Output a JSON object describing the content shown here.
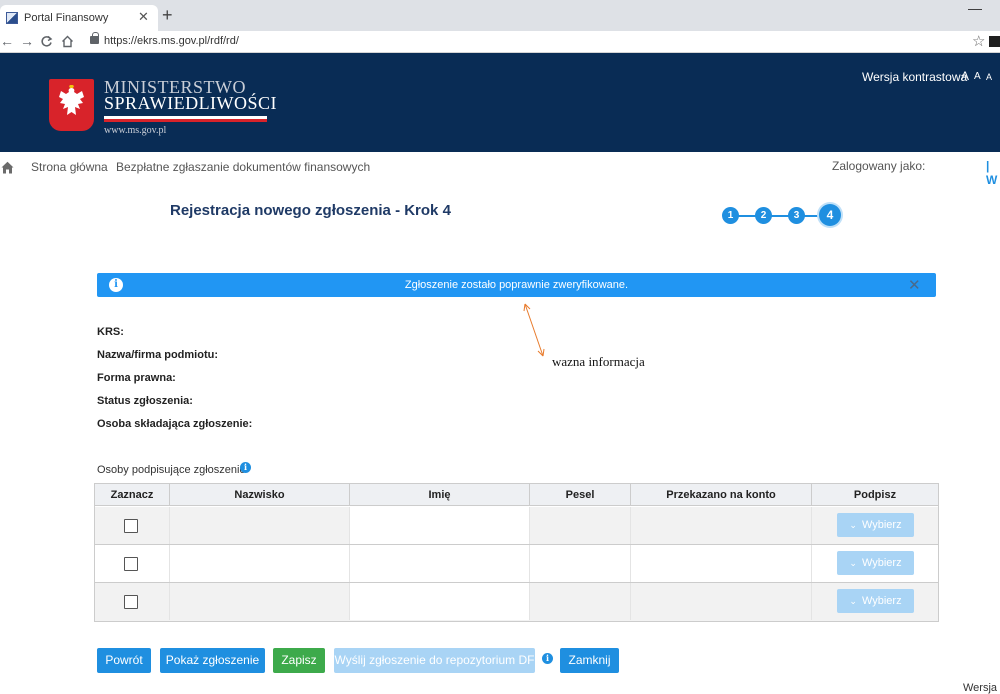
{
  "browser": {
    "tab_title": "Portal Finansowy",
    "tab_close": "✕",
    "new_tab": "+",
    "url": "https://ekrs.ms.gov.pl/rdf/rd/",
    "minimize": "—",
    "star": "☆",
    "back": "←",
    "forward": "→",
    "reload": "C"
  },
  "header": {
    "logo_line1": "MINISTERSTWO",
    "logo_line2": "SPRAWIEDLIWOŚCI",
    "logo_url": "www.ms.gov.pl",
    "contrast_label": "Wersja kontrastowa",
    "font_big": "A",
    "font_mid": "A",
    "font_small": "A",
    "colors": {
      "background": "#092c55",
      "emblem": "#d8232a"
    }
  },
  "breadcrumb": {
    "home_icon": "home-icon",
    "item1": "Strona główna",
    "item2": "Bezpłatne zgłaszanie dokumentów finansowych",
    "logged_label": "Zalogowany jako:",
    "logged_tail": "| W"
  },
  "main": {
    "title": "Rejestracja nowego zgłoszenia - Krok 4",
    "steps": [
      "1",
      "2",
      "3",
      "4"
    ],
    "active_step": 4,
    "alert": {
      "icon": "i",
      "text": "Zgłoszenie zostało poprawnie zweryfikowane.",
      "close": "✕",
      "color": "#2196f3"
    },
    "annotation": "wazna informacja",
    "fields": [
      "KRS:",
      "Nazwa/firma podmiotu:",
      "Forma prawna:",
      "Status zgłoszenia:",
      "Osoba składająca zgłoszenie:"
    ],
    "signers_label": "Osoby podpisujące zgłoszenie",
    "table": {
      "headers": [
        "Zaznacz",
        "Nazwisko",
        "Imię",
        "Pesel",
        "Przekazano na konto",
        "Podpisz"
      ],
      "rows": [
        {
          "button": "Wybierz"
        },
        {
          "button": "Wybierz"
        },
        {
          "button": "Wybierz"
        }
      ]
    },
    "buttons": {
      "back": "Powrót",
      "show": "Pokaż zgłoszenie",
      "save": "Zapisz",
      "send": "Wyślij zgłoszenie do repozytorium DF",
      "close": "Zamknij"
    },
    "bottom_text": "Wersja"
  }
}
